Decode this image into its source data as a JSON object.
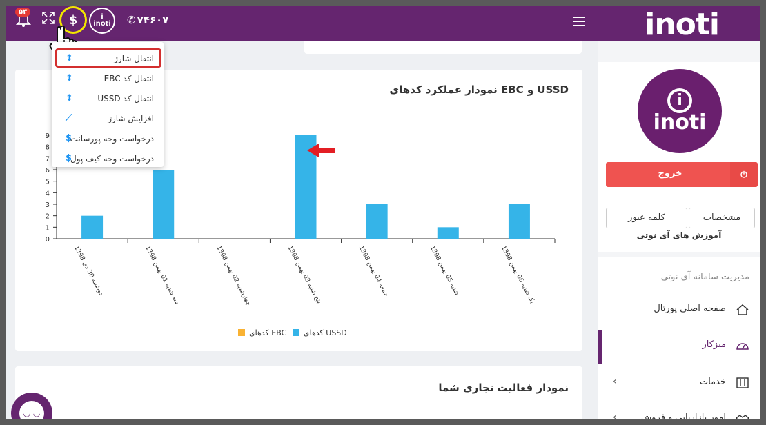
{
  "topbar": {
    "brand": "inoti",
    "phone": "۷۴۶۰۷",
    "notification_count": "۵۳",
    "logo_text_top": "i",
    "logo_text_bottom": "inoti",
    "dollar_symbol": "$",
    "accent_color": "#65256f"
  },
  "dropdown": {
    "items": [
      {
        "label": "انتقال شارژ",
        "icon": "transfer-icon",
        "glyph": "↕"
      },
      {
        "label": "EBC انتقال کد",
        "icon": "transfer-icon",
        "glyph": "↕"
      },
      {
        "label": "USSD انتقال کد",
        "icon": "transfer-icon",
        "glyph": "↕"
      },
      {
        "label": "افزایش شارژ",
        "icon": "chart-up-icon",
        "glyph": "⟋"
      },
      {
        "label": "درخواست وجه پورسانت",
        "icon": "dollar-icon",
        "glyph": "$"
      },
      {
        "label": "درخواست وجه کیف پول",
        "icon": "dollar-icon",
        "glyph": "$"
      }
    ]
  },
  "sidebar": {
    "avatar_top": "i",
    "avatar_word": "inoti",
    "logout_label": "خروج",
    "profile_label": "مشخصات",
    "password_label": "کلمه عبور",
    "learn_label": "آموزش های آی نوتی",
    "section_title": "مدیریت سامانه آی نوتی",
    "menu": [
      {
        "label": "صفحه اصلی پورتال",
        "icon": "home-icon"
      },
      {
        "label": "میزکار",
        "icon": "dashboard-icon"
      },
      {
        "label": "خدمات",
        "icon": "services-icon"
      },
      {
        "label": "امور بازاریابی و فروش",
        "icon": "handshake-icon"
      }
    ]
  },
  "main": {
    "chart_title": "نمودار عملکرد کدهای EBC و USSD",
    "activity_title": "نمودار فعالیت تجاری شما"
  },
  "chart_data": {
    "type": "bar",
    "title": "نمودار عملکرد کدهای EBC و USSD",
    "categories": [
      "دوشنبه 30 دی 1398",
      "سه شنبه 01 بهمن 1398",
      "چهارشنبه 02 بهمن 1398",
      "پنج شنبه 03 بهمن 1398",
      "جمعه 04 بهمن 1398",
      "شنبه 05 بهمن 1398",
      "یک شنبه 06 بهمن 1398"
    ],
    "series": [
      {
        "name": "کدهای EBC",
        "color": "#f9b233",
        "values": [
          0,
          0,
          0,
          0,
          0,
          0,
          0
        ]
      },
      {
        "name": "کدهای USSD",
        "color": "#35b4e8",
        "values": [
          2,
          6,
          0,
          9,
          3,
          1,
          3
        ]
      }
    ],
    "ylim": [
      0,
      9
    ],
    "yticks": [
      0,
      1,
      2,
      3,
      4,
      5,
      6,
      7,
      8,
      9
    ],
    "legend": "bottom",
    "grid": false
  }
}
